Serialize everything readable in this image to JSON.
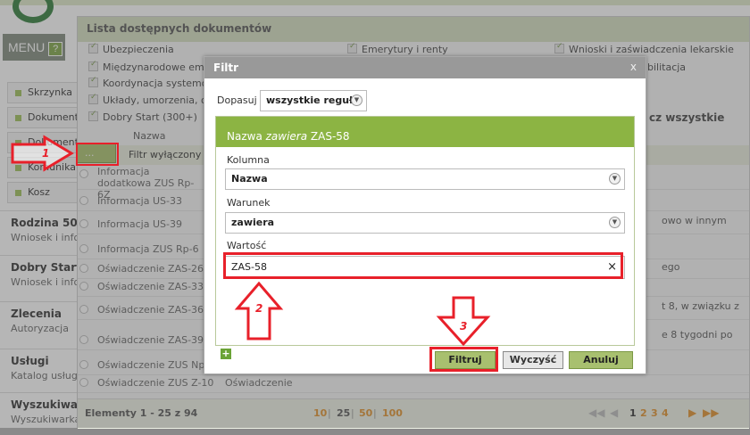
{
  "sidebar": {
    "menu_label": "MENU",
    "help_label": "?",
    "items": [
      {
        "label": "Skrzynka"
      },
      {
        "label": "Dokumenty"
      },
      {
        "label": "Dokumenty"
      },
      {
        "label": "Komunikaty"
      },
      {
        "label": "Kosz"
      }
    ],
    "sections": [
      {
        "title": "Rodzina 50",
        "sub": "Wniosek i info"
      },
      {
        "title": "Dobry Start",
        "sub": "Wniosek i info"
      },
      {
        "title": "Zlecenia",
        "sub": "Autoryzacja"
      },
      {
        "title": "Usługi",
        "sub": "Katalog usług"
      },
      {
        "title": "Wyszukiwanie",
        "sub": "Wyszukiwarka"
      }
    ]
  },
  "panel": {
    "title": "Lista dostępnych dokumentów",
    "categories": [
      "Ubezpieczenia",
      "Międzynarodowe eme",
      "Koordynacja systemó",
      "Układy, umorzenia, o",
      "Dobry Start (300+)",
      "Emerytury i renty",
      "Wnioski i zaświadczenia lekarskie",
      "bilitacja"
    ],
    "check_all": "cz wszystkie",
    "column_name": "Nazwa",
    "dots_button": "...",
    "filter_status": "Filtr wyłączony",
    "rows": [
      {
        "name": "Informacja dodatkowa ZUS Rp-6Z",
        "desc": ""
      },
      {
        "name": "Informacja US-33",
        "desc": ""
      },
      {
        "name": "Informacja US-39",
        "desc": ""
      },
      {
        "name": "Informacja ZUS Rp-6",
        "desc": ""
      },
      {
        "name": "Oświadczenie ZAS-26",
        "desc": ""
      },
      {
        "name": "Oświadczenie ZAS-33",
        "desc": ""
      },
      {
        "name": "Oświadczenie ZAS-36",
        "desc": ""
      },
      {
        "name": "Oświadczenie ZAS-39",
        "desc": ""
      },
      {
        "name": "Oświadczenie ZUS Np-7",
        "desc": ""
      },
      {
        "name": "Oświadczenie ZUS Z-10",
        "desc": "Oświadczenie"
      }
    ],
    "right_fragments": [
      "owo w innym",
      "ego",
      "t 8, w związku z",
      "e 8 tygodni po"
    ],
    "footer": {
      "elements": "Elementy 1 - 25 z 94",
      "page_sizes": [
        "10",
        "25",
        "50",
        "100"
      ],
      "pages": [
        "1",
        "2",
        "3",
        "4"
      ]
    }
  },
  "dialog": {
    "title": "Filtr",
    "close": "x",
    "match_label": "Dopasuj",
    "match_value": "wszystkie reguły",
    "rule_title_prefix": "Nazwa ",
    "rule_title_op": "zawiera",
    "rule_title_value": " ZAS-58",
    "column_label": "Kolumna",
    "column_value": "Nazwa",
    "condition_label": "Warunek",
    "condition_value": "zawiera",
    "value_label": "Wartość",
    "value_input": "ZAS-58",
    "add": "+",
    "buttons": {
      "filter": "Filtruj",
      "clear": "Wyczyść",
      "cancel": "Anuluj"
    }
  },
  "annotations": {
    "step1": "1",
    "step2": "2",
    "step3": "3"
  },
  "colors": {
    "accent_green": "#8cb443",
    "highlight_red": "#e8202a",
    "brand_green": "#2f7d3a"
  }
}
